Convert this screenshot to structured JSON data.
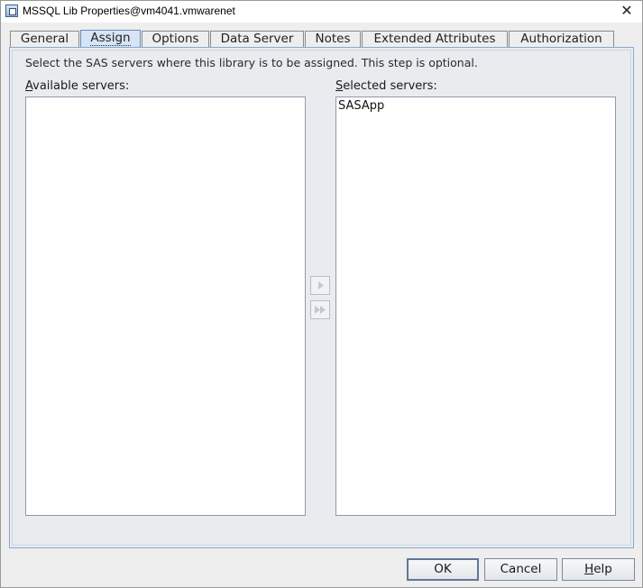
{
  "window": {
    "title": "MSSQL Lib Properties@vm4041.vmwarenet",
    "close_glyph": "✕"
  },
  "tabs": [
    {
      "label": "General",
      "active": false
    },
    {
      "label": "Assign",
      "active": true
    },
    {
      "label": "Options",
      "active": false
    },
    {
      "label": "Data Server",
      "active": false
    },
    {
      "label": "Notes",
      "active": false
    },
    {
      "label": "Extended Attributes",
      "active": false
    },
    {
      "label": "Authorization",
      "active": false
    }
  ],
  "assign": {
    "instruction": "Select the SAS servers where this library is to be assigned. This step is optional.",
    "available": {
      "label_mnemonic": "A",
      "label_rest": "vailable servers:",
      "items": []
    },
    "selected": {
      "label_mnemonic": "S",
      "label_rest": "elected servers:",
      "items": [
        "SASApp"
      ]
    },
    "move_right_icon": "arrow-right-icon",
    "move_all_right_icon": "double-arrow-right-icon"
  },
  "buttons": {
    "ok": "OK",
    "cancel": "Cancel",
    "help_mnemonic": "H",
    "help_rest": "elp"
  },
  "colors": {
    "active_tab": "#d6e4f5",
    "panel_border": "#8aa7c9",
    "window_bg": "#eeeeee"
  }
}
